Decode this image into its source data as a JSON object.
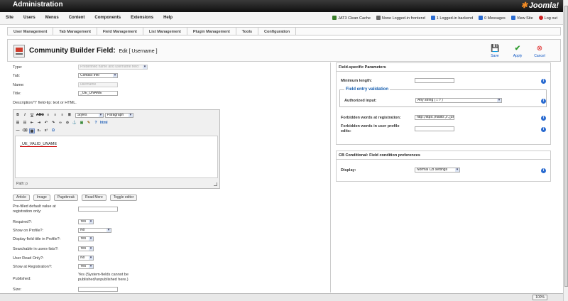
{
  "header": {
    "title": "Administration",
    "logo_text": "Joomla!"
  },
  "menu": [
    "Site",
    "Users",
    "Menus",
    "Content",
    "Components",
    "Extensions",
    "Help"
  ],
  "status": [
    {
      "label": "JAT3 Clean Cache",
      "color": "#3a7d2b"
    },
    {
      "label": "None Logged-in frontend",
      "color": "#666666"
    },
    {
      "label": "1 Logged-in backend",
      "color": "#2a6bd0"
    },
    {
      "label": "0 Messages",
      "color": "#2a6bd0"
    },
    {
      "label": "View Site",
      "color": "#2a6bd0"
    },
    {
      "label": "Log out",
      "color": "#cc2222"
    }
  ],
  "submenu": [
    "User Management",
    "Tab Management",
    "Field Management",
    "List Management",
    "Plugin Management",
    "Tools",
    "Configuration"
  ],
  "toolbar": {
    "title": "Community Builder Field:",
    "subtitle": "Edit [ Username ]",
    "save": "Save",
    "apply": "Apply",
    "cancel": "Cancel"
  },
  "form": {
    "type_label": "Type:",
    "type_value": "Predefined name and username field",
    "tab_label": "Tab:",
    "tab_value": "Contact Info",
    "name_label": "Name:",
    "name_value": "username",
    "title_label": "Title:",
    "title_value": "_UE_UNAME",
    "desc_label": "Description/\"i\" field-tip: text or HTML.",
    "styles_label": "Styles",
    "format_label": "Paragraph",
    "editor_text": "_UE_VALID_UNAME",
    "path_label": "Path: p",
    "editor_buttons": [
      "Article",
      "Image",
      "Pagebreak",
      "Read More",
      "Toggle editor"
    ],
    "prefill_label": "Pre-filled default value at registration only:",
    "required_label": "Required?:",
    "required_value": "Yes",
    "profile_label": "Show on Profile?:",
    "profile_value": "No",
    "display_title_label": "Display field title in Profile?:",
    "display_title_value": "Yes",
    "searchable_label": "Searchable in users-lists?:",
    "searchable_value": "Yes",
    "readonly_label": "User Read Only?:",
    "readonly_value": "No",
    "registration_label": "Show at Registration?:",
    "registration_value": "Yes",
    "published_label": "Published:",
    "published_value": "Yes (System-fields cannot be published/unpublished here.)",
    "size_label": "Size:"
  },
  "params": {
    "header": "Field-specific Parameters",
    "min_length_label": "Minimum length:",
    "validation_legend": "Field entry validation",
    "authorized_label": "Authorized input:",
    "authorized_value": "Any string ( /.*/ )",
    "forbidden_reg_label": "Forbidden words at registration:",
    "forbidden_reg_value": "http:,https:,mailto:,//.,[url],<a,</a>,&#",
    "forbidden_edit_label": "Forbidden words in user profile edits:"
  },
  "conditional": {
    "header": "CB Conditional: Field condition preferences",
    "display_label": "Display:",
    "display_value": "Normal CB settings"
  },
  "statusbar": {
    "zoom": "100%"
  },
  "icons": {
    "info": "i",
    "save": "floppy-disk",
    "apply": "check-mark",
    "cancel": "cancel-circle"
  }
}
